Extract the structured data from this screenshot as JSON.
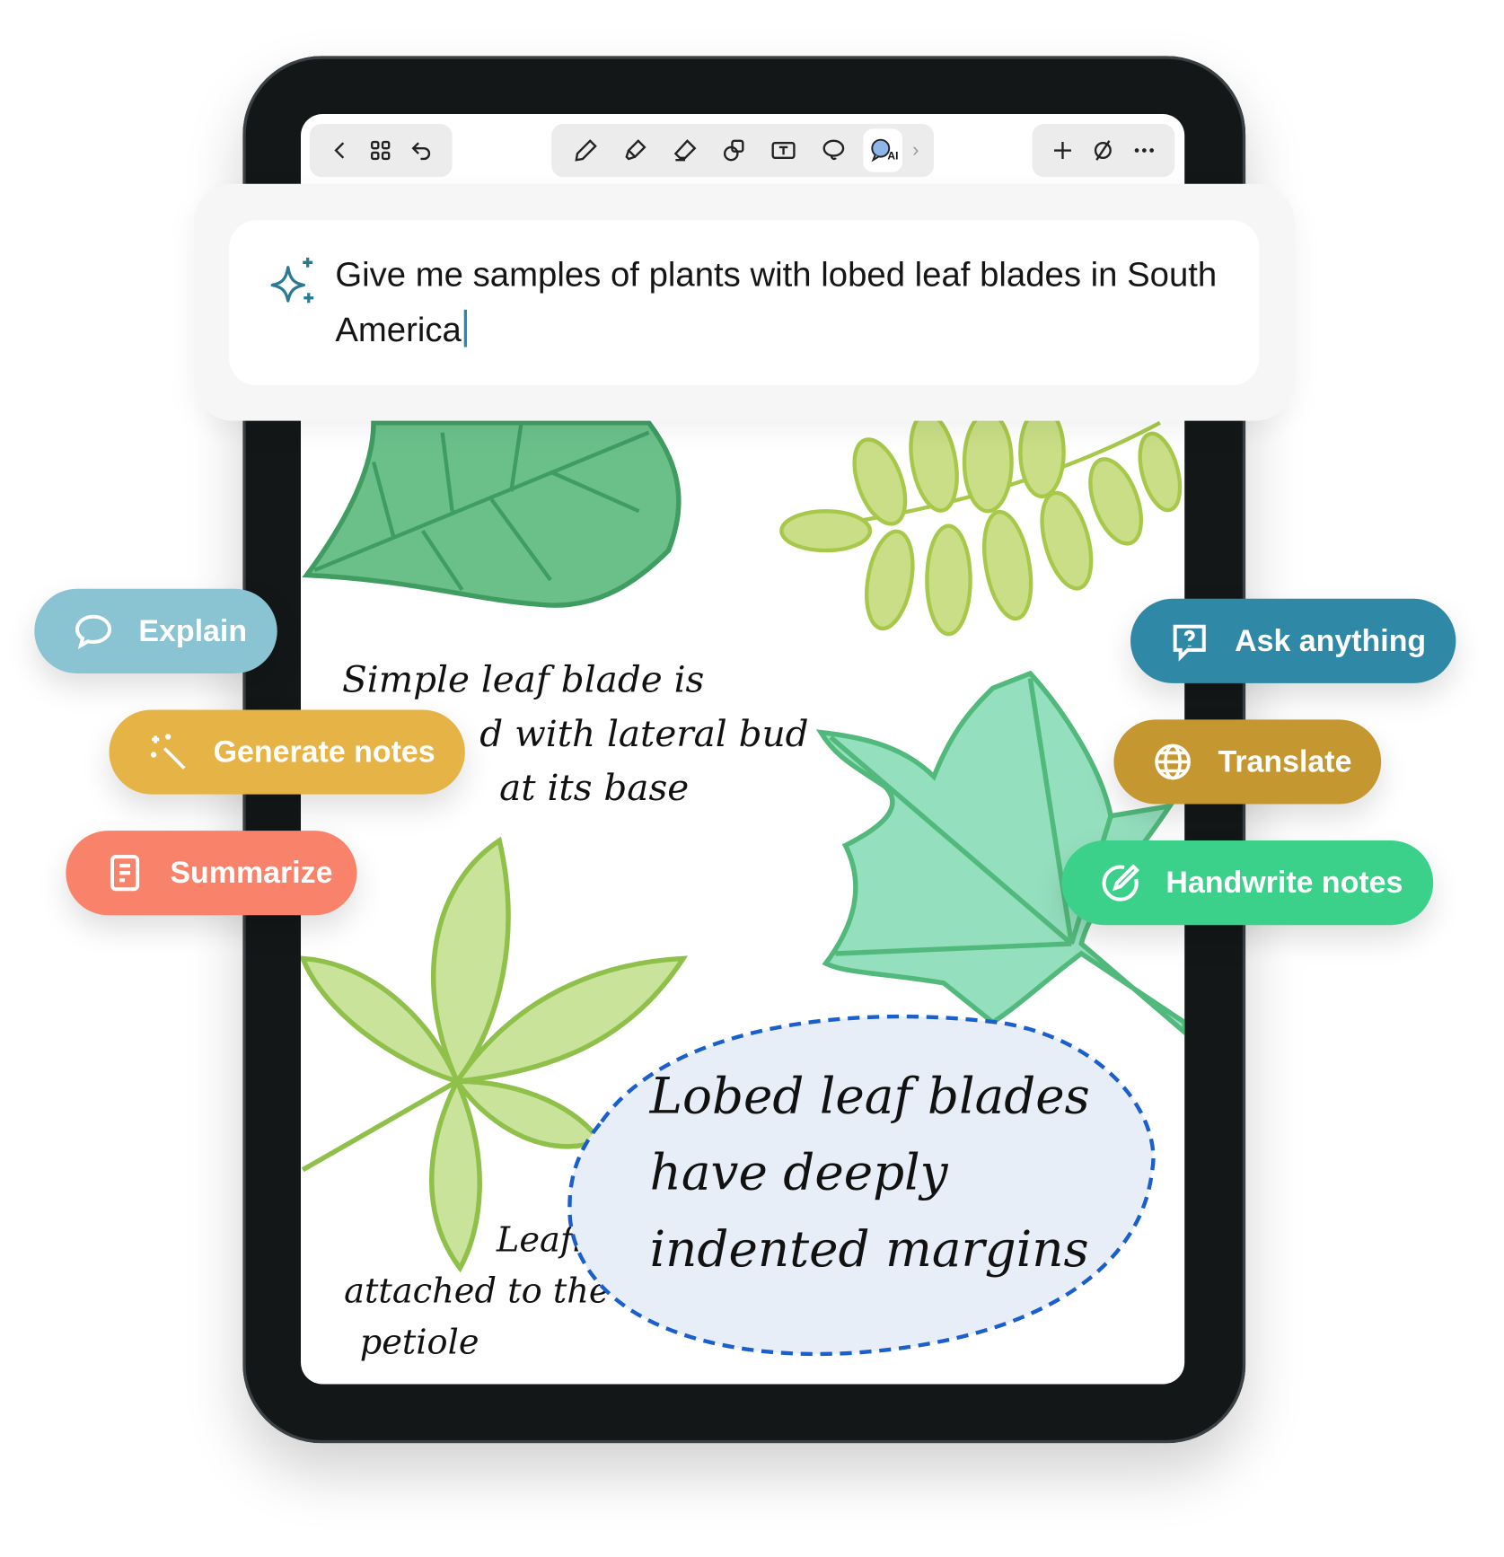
{
  "toolbar": {
    "left": [
      "back-icon",
      "grid-icon",
      "undo-icon"
    ],
    "tools": [
      "pen-icon",
      "highlighter-icon",
      "eraser-icon",
      "shapes-icon",
      "text-box-icon",
      "lasso-icon",
      "ai-chat-icon",
      "chevron-right-icon"
    ],
    "active_tool": "ai-chat-icon",
    "ai_badge": "AI",
    "right": [
      "add-icon",
      "hide-icon",
      "more-icon"
    ]
  },
  "ai_prompt": {
    "text": "Give me samples of plants with lobed leaf blades in South America",
    "icon": "sparkle-icon",
    "accent": "#2a7a94"
  },
  "actions": [
    {
      "label": "Explain",
      "icon": "speech-bubble-icon",
      "color": "#8ac4d2"
    },
    {
      "label": "Generate notes",
      "icon": "magic-wand-icon",
      "color": "#e6b446"
    },
    {
      "label": "Summarize",
      "icon": "document-icon",
      "color": "#f8826a"
    },
    {
      "label": "Ask anything",
      "icon": "question-bubble-icon",
      "color": "#2e88a6"
    },
    {
      "label": "Translate",
      "icon": "globe-icon",
      "color": "#c59731"
    },
    {
      "label": "Handwrite notes",
      "icon": "pen-circle-icon",
      "color": "#3bd18a"
    }
  ],
  "notes": {
    "simple_leaf": [
      "Simple leaf blade is",
      "d with lateral bud",
      "at its base"
    ],
    "leaflets": [
      "Leafle",
      "attached to the ti",
      "petiole"
    ],
    "lobed_callout": [
      "Lobed leaf blades",
      "have deeply",
      "indented margins"
    ],
    "callout_border": "#1a5fcc",
    "callout_fill": "#e8eef8"
  }
}
